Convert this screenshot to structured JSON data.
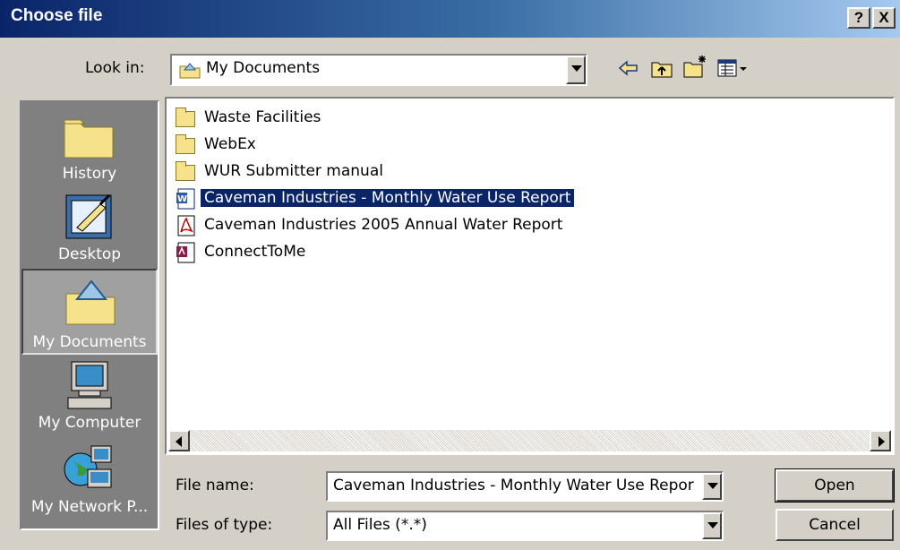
{
  "window": {
    "title": "Choose file"
  },
  "titlebar_buttons": {
    "help": "?",
    "close": "X"
  },
  "look_in": {
    "label": "Look in:",
    "value": "My Documents"
  },
  "places": [
    {
      "label": "History",
      "icon": "history-folder-icon"
    },
    {
      "label": "Desktop",
      "icon": "desktop-icon"
    },
    {
      "label": "My Documents",
      "icon": "my-documents-icon",
      "selected": true
    },
    {
      "label": "My Computer",
      "icon": "my-computer-icon"
    },
    {
      "label": "My Network P...",
      "icon": "network-places-icon"
    }
  ],
  "files": [
    {
      "name": "Waste Facilities",
      "type": "folder"
    },
    {
      "name": "WebEx",
      "type": "folder"
    },
    {
      "name": "WUR Submitter manual",
      "type": "folder"
    },
    {
      "name": "Caveman Industries - Monthly Water Use Report",
      "type": "word",
      "selected": true
    },
    {
      "name": "Caveman Industries 2005 Annual Water Report",
      "type": "pdf"
    },
    {
      "name": "ConnectToMe",
      "type": "access"
    }
  ],
  "file_name": {
    "label": "File name:",
    "value": "Caveman Industries - Monthly Water Use Repor"
  },
  "files_of_type": {
    "label": "Files of type:",
    "value": "All Files (*.*)"
  },
  "buttons": {
    "open": "Open",
    "cancel": "Cancel"
  },
  "colors": {
    "title_start": "#0a246a",
    "title_end": "#a6caf0",
    "face": "#d4d0c8",
    "selection": "#0a246a"
  }
}
